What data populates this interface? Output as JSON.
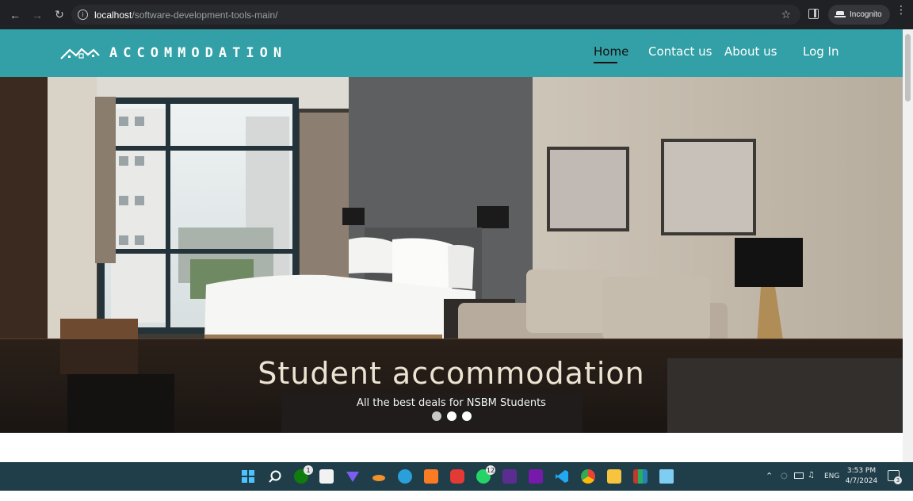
{
  "browser": {
    "url_host": "localhost",
    "url_path": "/software-development-tools-main/",
    "incognito_label": "Incognito"
  },
  "site": {
    "logo_text": "ACCOMMODATION",
    "nav": [
      {
        "label": "Home",
        "active": true
      },
      {
        "label": "Contact us",
        "active": false
      },
      {
        "label": "About us",
        "active": false
      },
      {
        "label": "Log In",
        "active": false
      }
    ]
  },
  "hero": {
    "title": "Student accommodation",
    "subtitle": "All the best deals for NSBM Students",
    "slides_count": 3,
    "active_slide": 1
  },
  "taskbar": {
    "badges": {
      "xbox": "1",
      "whatsapp": "12"
    },
    "tray_language": "ENG",
    "time": "3:53 PM",
    "date": "4/7/2024",
    "notification_count": "3"
  }
}
